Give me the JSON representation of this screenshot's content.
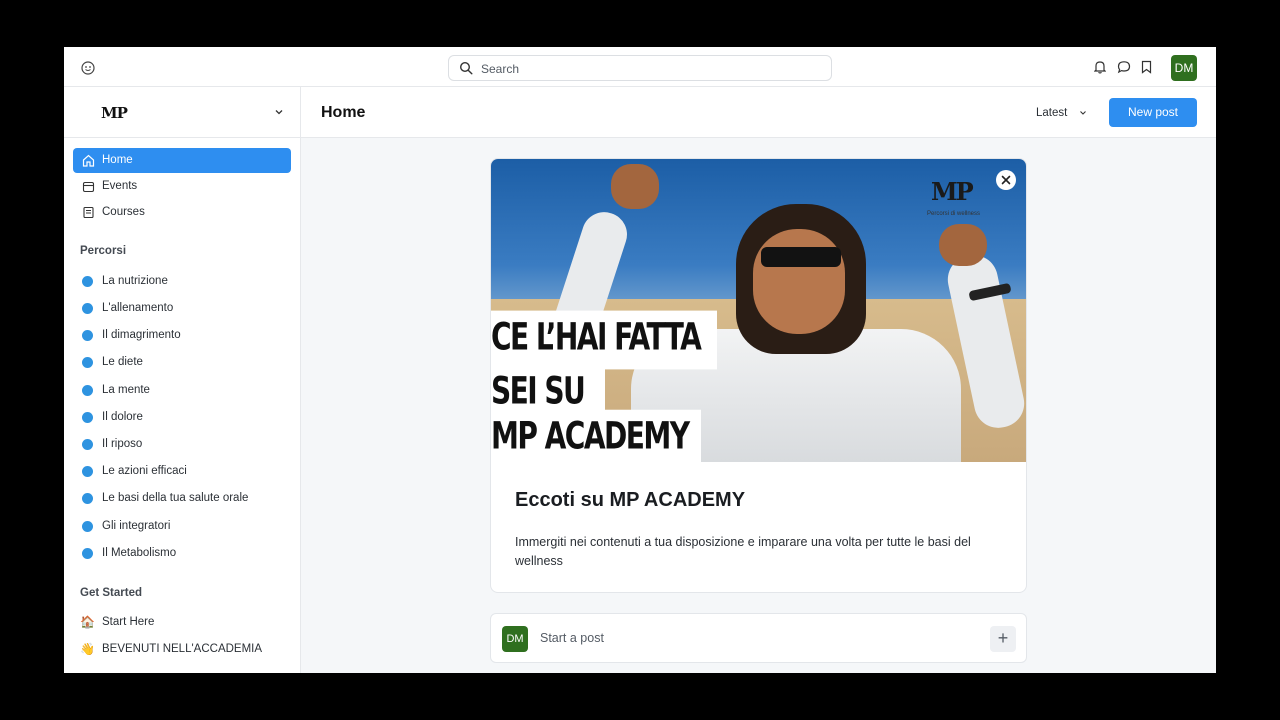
{
  "topbar": {
    "search_placeholder": "Search",
    "user_initials": "DM"
  },
  "sidebar": {
    "brand": "MP",
    "nav": [
      {
        "label": "Home",
        "icon": "home-icon",
        "active": true
      },
      {
        "label": "Events",
        "icon": "calendar-icon",
        "active": false
      },
      {
        "label": "Courses",
        "icon": "book-icon",
        "active": false
      }
    ],
    "paths_title": "Percorsi",
    "paths": [
      "La nutrizione",
      "L'allenamento",
      "Il dimagrimento",
      "Le diete",
      "La mente",
      "Il dolore",
      "Il riposo",
      "Le azioni efficaci",
      "Le basi della tua salute orale",
      "Gli integratori",
      "Il Metabolismo"
    ],
    "get_started_title": "Get Started",
    "get_started": [
      {
        "emoji": "🏠",
        "label": "Start Here"
      },
      {
        "emoji": "👋",
        "label": "BEVENUTI NELL'ACCADEMIA"
      }
    ]
  },
  "main": {
    "title": "Home",
    "sort_label": "Latest",
    "new_post_label": "New post"
  },
  "welcome_card": {
    "hero_lines": [
      "CE L’HAI FATTA",
      "SEI  SU",
      "MP ACADEMY"
    ],
    "hero_logo": "MP",
    "hero_logo_sub": "Percorsi di wellness",
    "title": "Eccoti su MP ACADEMY",
    "body": "Immergiti nei contenuti a tua disposizione e imparare una volta per tutte le basi del wellness"
  },
  "composer": {
    "user_initials": "DM",
    "placeholder": "Start a post",
    "plus": "+"
  },
  "colors": {
    "accent": "#2e8ef0",
    "path_dot": "#2e93e0",
    "avatar": "#2f6f1f"
  }
}
